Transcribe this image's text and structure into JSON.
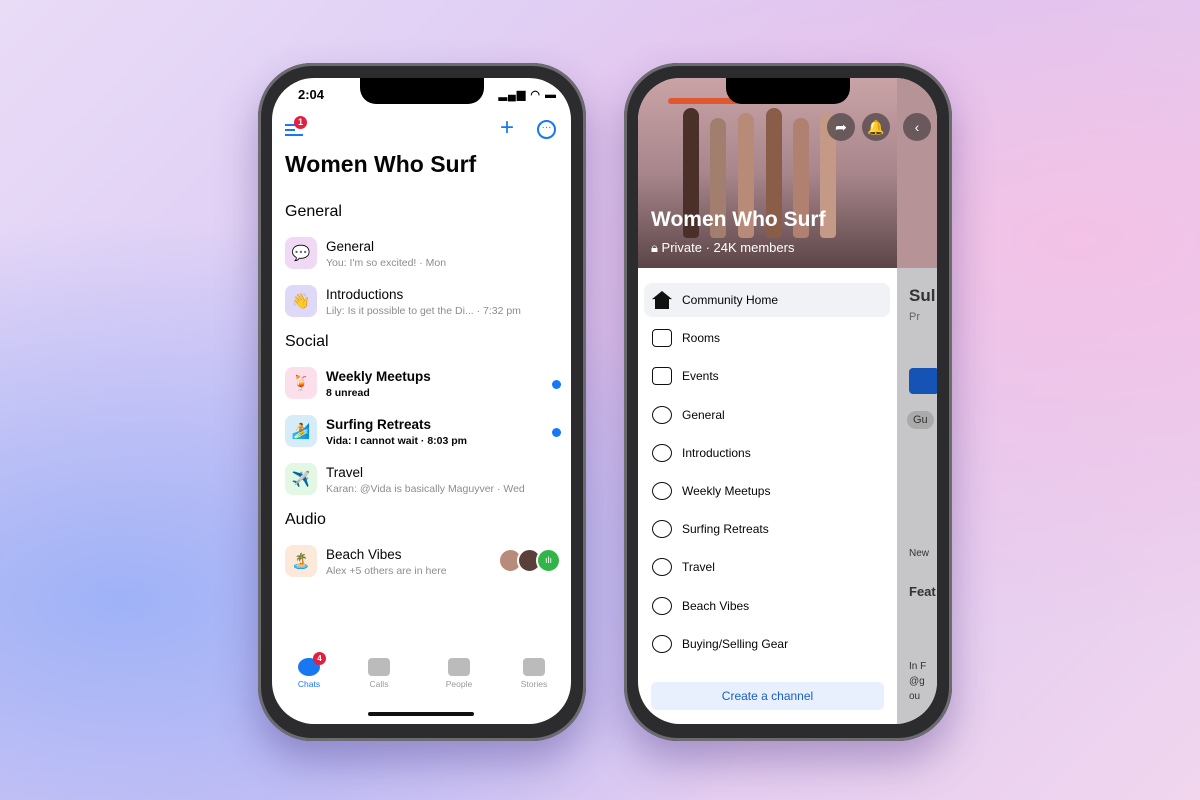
{
  "left_phone": {
    "status_time": "2:04",
    "menu_badge": "1",
    "title": "Women Who Surf",
    "sections": [
      {
        "label": "General",
        "rows": [
          {
            "name": "General",
            "sub": "You: I'm so excited!  · Mon",
            "emoji": "💬",
            "bg": "#f0d9f5",
            "unread": false
          },
          {
            "name": "Introductions",
            "sub": "Lily: Is it possible to get the Di...  · 7:32 pm",
            "emoji": "👋",
            "bg": "#ddd9f7",
            "unread": false
          }
        ]
      },
      {
        "label": "Social",
        "rows": [
          {
            "name": "Weekly Meetups",
            "sub": "8 unread",
            "emoji": "🍹",
            "bg": "#fbe0ec",
            "unread": true
          },
          {
            "name": "Surfing Retreats",
            "sub": "Vida: I cannot wait · 8:03 pm",
            "emoji": "🏄",
            "bg": "#d6ecf7",
            "unread": true
          },
          {
            "name": "Travel",
            "sub": "Karan: @Vida is basically Maguyver · Wed",
            "emoji": "✈️",
            "bg": "#e2f7e4",
            "unread": false
          }
        ]
      },
      {
        "label": "Audio",
        "rows": [
          {
            "name": "Beach Vibes",
            "sub": "Alex +5 others are in here",
            "emoji": "🏝️",
            "bg": "#fde9d9",
            "unread": false
          }
        ]
      }
    ],
    "tabs": [
      {
        "label": "Chats",
        "badge": "4",
        "active": true
      },
      {
        "label": "Calls"
      },
      {
        "label": "People"
      },
      {
        "label": "Stories"
      }
    ],
    "accent": "#1877f2"
  },
  "right_phone": {
    "title": "Women Who Surf",
    "subtitle": "Private · 24K members",
    "nav": [
      {
        "label": "Community Home",
        "icon": "home-icon",
        "active": true
      },
      {
        "label": "Rooms",
        "icon": "video-plus-icon"
      },
      {
        "label": "Events",
        "icon": "calendar-icon"
      },
      {
        "label": "General",
        "icon": "chat-globe-icon"
      },
      {
        "label": "Introductions",
        "icon": "chat-globe-icon"
      },
      {
        "label": "Weekly Meetups",
        "icon": "chat-globe-icon"
      },
      {
        "label": "Surfing Retreats",
        "icon": "chat-lock-icon"
      },
      {
        "label": "Travel",
        "icon": "chat-lock-icon"
      },
      {
        "label": "Beach Vibes",
        "icon": "audio-lock-icon"
      },
      {
        "label": "Buying/Selling Gear",
        "icon": "marketplace-globe-icon"
      }
    ],
    "create_button": "Create a channel",
    "side_fragments": {
      "title": "Sul",
      "privacy": "Pr",
      "chip": "Gu",
      "new": "New",
      "featured": "Feat",
      "post1": "In F",
      "post2": "@g",
      "post3": "ou"
    }
  }
}
